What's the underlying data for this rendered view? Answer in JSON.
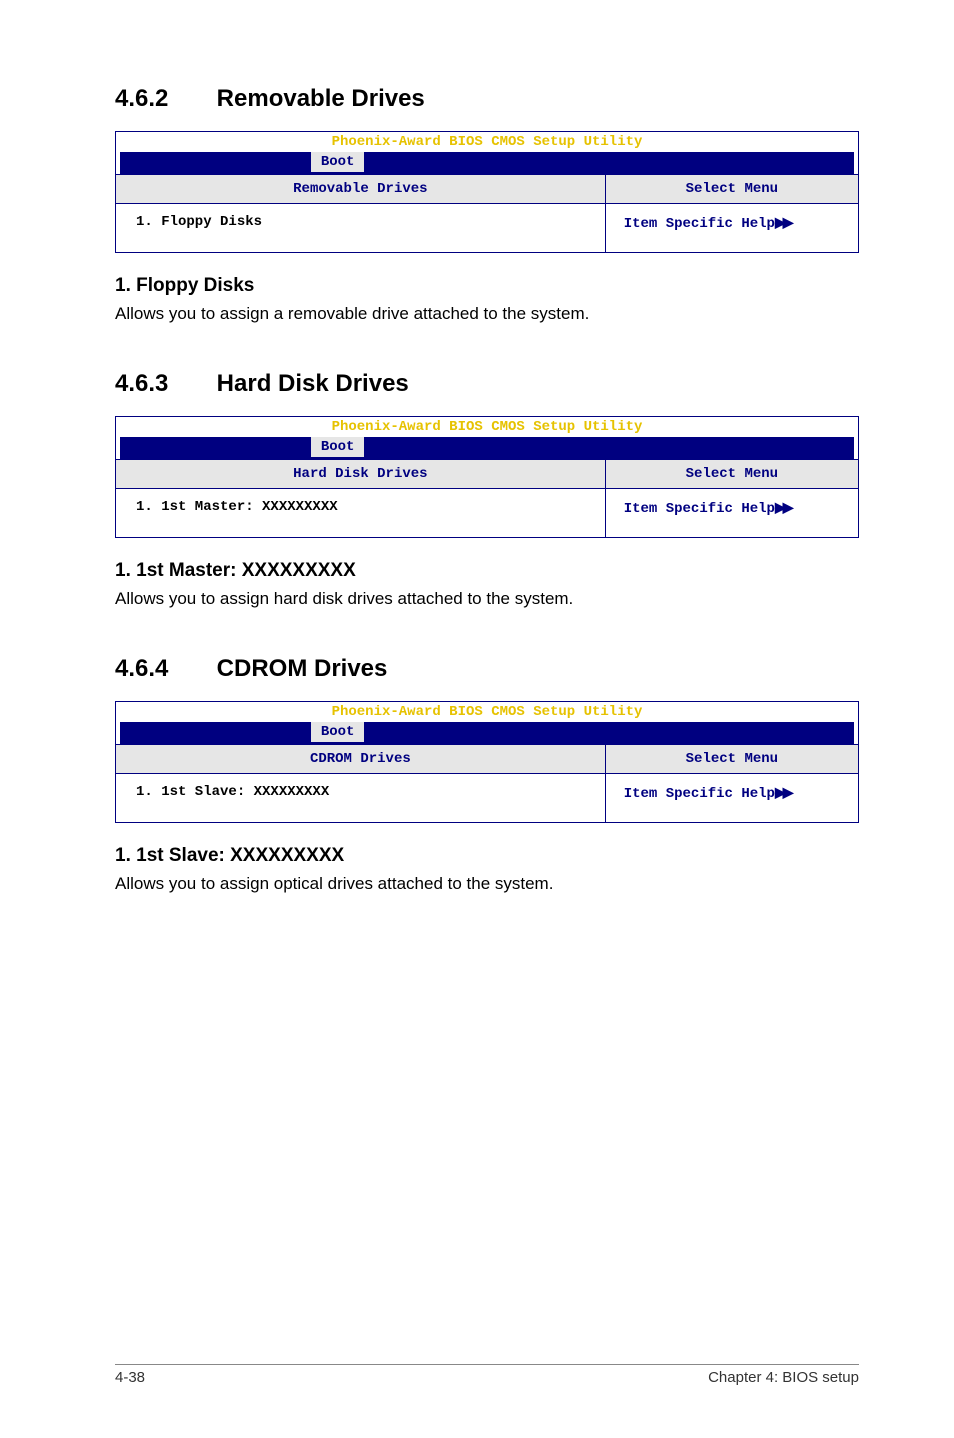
{
  "sections": {
    "s1": {
      "num": "4.6.2",
      "title": "Removable Drives",
      "bios": {
        "utility_title": "Phoenix-Award BIOS CMOS Setup Utility",
        "tab": "Boot",
        "left_header": "Removable Drives",
        "right_header": "Select Menu",
        "left_body": "1. Floppy Disks",
        "right_body": "Item Specific Help"
      },
      "sub": "1. Floppy Disks",
      "desc": "Allows you to assign a removable drive attached to the system."
    },
    "s2": {
      "num": "4.6.3",
      "title": "Hard Disk Drives",
      "bios": {
        "utility_title": "Phoenix-Award BIOS CMOS Setup Utility",
        "tab": "Boot",
        "left_header": "Hard Disk Drives",
        "right_header": "Select Menu",
        "left_body": "1. 1st Master: XXXXXXXXX",
        "right_body": "Item Specific Help"
      },
      "sub": "1. 1st Master: XXXXXXXXX",
      "desc": "Allows you to assign hard disk drives attached to the system."
    },
    "s3": {
      "num": "4.6.4",
      "title": "CDROM Drives",
      "bios": {
        "utility_title": "Phoenix-Award BIOS CMOS Setup Utility",
        "tab": "Boot",
        "left_header": "CDROM Drives",
        "right_header": "Select Menu",
        "left_body": "1. 1st Slave: XXXXXXXXX",
        "right_body": "Item Specific Help"
      },
      "sub": "1. 1st Slave: XXXXXXXXX",
      "desc": "Allows you to assign optical drives attached to the system."
    }
  },
  "footer": {
    "left": "4-38",
    "right": "Chapter 4: BIOS setup"
  }
}
